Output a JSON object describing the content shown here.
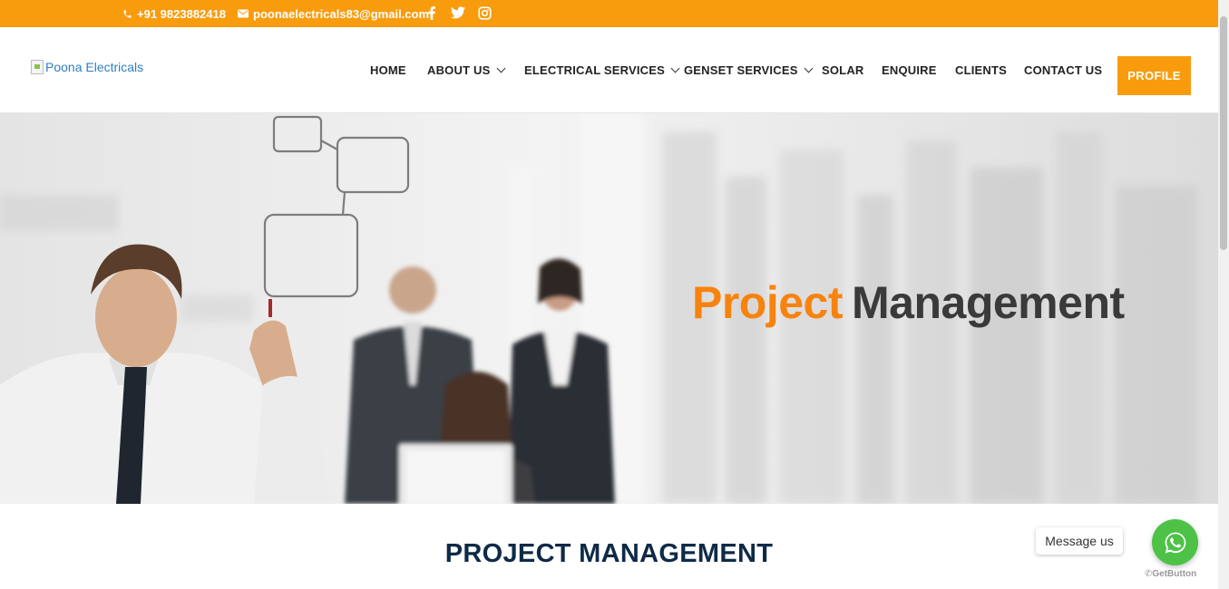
{
  "topbar": {
    "phone": "+91 9823882418",
    "email": "poonaelectricals83@gmail.com",
    "social": [
      "facebook-icon",
      "twitter-icon",
      "instagram-icon"
    ],
    "bg_color": "#f89c0e"
  },
  "header": {
    "logo_alt": "Poona Electricals",
    "nav": [
      {
        "label": "HOME",
        "dropdown": false
      },
      {
        "label": "ABOUT US",
        "dropdown": true
      },
      {
        "label": "ELECTRICAL SERVICES",
        "dropdown": true
      },
      {
        "label": "GENSET SERVICES",
        "dropdown": true
      },
      {
        "label": "SOLAR",
        "dropdown": false
      },
      {
        "label": "ENQUIRE",
        "dropdown": false
      },
      {
        "label": "CLIENTS",
        "dropdown": false
      },
      {
        "label": "CONTACT US",
        "dropdown": false
      }
    ],
    "profile_label": "PROFILE"
  },
  "hero": {
    "title_word1": "Project",
    "title_word2": "Management"
  },
  "section": {
    "title": "PROJECT MANAGEMENT"
  },
  "whatsapp": {
    "message_label": "Message us",
    "brand": "GetButton"
  },
  "colors": {
    "accent": "#f89c0e",
    "heading": "#0e2a47",
    "whatsapp": "#4dc247"
  }
}
